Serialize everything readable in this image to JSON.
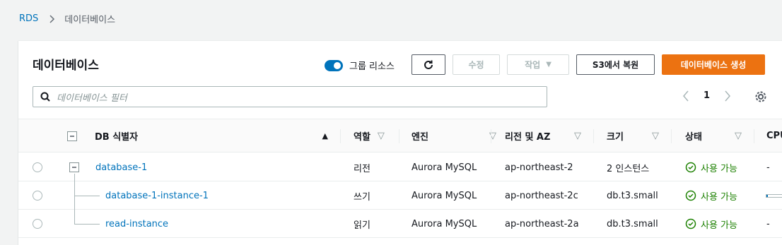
{
  "breadcrumb": {
    "root": "RDS",
    "current": "데이터베이스"
  },
  "panel": {
    "title": "데이터베이스",
    "toggle_label": "그룹 리소스",
    "buttons": {
      "modify": "수정",
      "actions": "작업",
      "restore_s3": "S3에서 복원",
      "create": "데이터베이스 생성"
    },
    "search_placeholder": "데이터베이스 필터",
    "page": "1"
  },
  "columns": [
    "DB 식별자",
    "역할",
    "엔진",
    "리전 및 AZ",
    "크기",
    "상태",
    "CPU"
  ],
  "rows": [
    {
      "id": "database-1",
      "role": "리전",
      "engine": "Aurora MySQL",
      "region": "ap-northeast-2",
      "size": "2 인스턴스",
      "status": "사용 가능",
      "cpu": "-"
    },
    {
      "id": "database-1-instance-1",
      "role": "쓰기",
      "engine": "Aurora MySQL",
      "region": "ap-northeast-2c",
      "size": "db.t3.small",
      "status": "사용 가능",
      "cpu": ""
    },
    {
      "id": "read-instance",
      "role": "읽기",
      "engine": "Aurora MySQL",
      "region": "ap-northeast-2a",
      "size": "db.t3.small",
      "status": "사용 가능",
      "cpu": "-"
    }
  ],
  "colors": {
    "accent": "#0073bb",
    "primary": "#ec7211",
    "success": "#1d8102"
  }
}
